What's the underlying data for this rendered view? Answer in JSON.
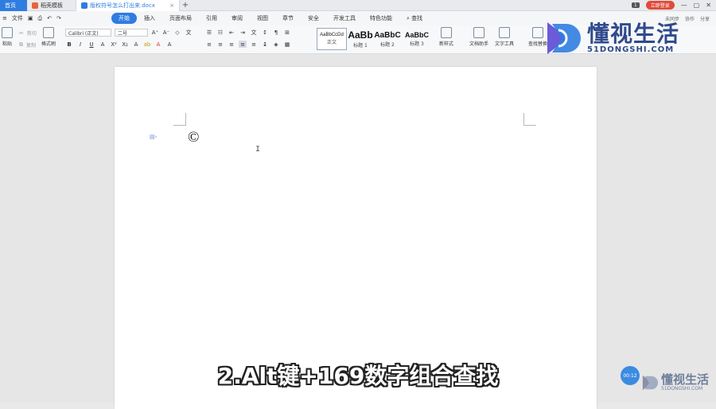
{
  "tabs": {
    "home": "首页",
    "template": "稻壳模板",
    "doc": "版权符号怎么打出来.docx"
  },
  "topbar": {
    "badge": "1",
    "login": "立即登录"
  },
  "menubar": {
    "file": "文件",
    "tabs": [
      "开始",
      "插入",
      "页面布局",
      "引用",
      "审阅",
      "视图",
      "章节",
      "安全",
      "开发工具",
      "特色功能"
    ],
    "search": "查找",
    "right": [
      "未同步",
      "协作",
      "分享"
    ]
  },
  "ribbon": {
    "paste": "粘贴",
    "cut": "剪切",
    "copy": "复制",
    "format_painter": "格式刷",
    "font": "Calibri (正文)",
    "size": "二号",
    "styles": [
      {
        "sample": "AaBbCcDd",
        "label": "正文"
      },
      {
        "sample": "AaBb",
        "label": "标题 1"
      },
      {
        "sample": "AaBbC",
        "label": "标题 2"
      },
      {
        "sample": "AaBbC",
        "label": "标题 3"
      }
    ],
    "new_style": "新样式",
    "doc_assistant": "文档助手",
    "text_tools": "文字工具",
    "find_replace": "查找替换"
  },
  "document": {
    "text": "©"
  },
  "watermark": {
    "cn": "懂视生活",
    "en": "51DONGSHI.COM"
  },
  "caption": "2.Alt键+169数字组合查找",
  "timer": "00:12",
  "colors": {
    "accent": "#2f7de1",
    "login": "#e04a3a"
  }
}
